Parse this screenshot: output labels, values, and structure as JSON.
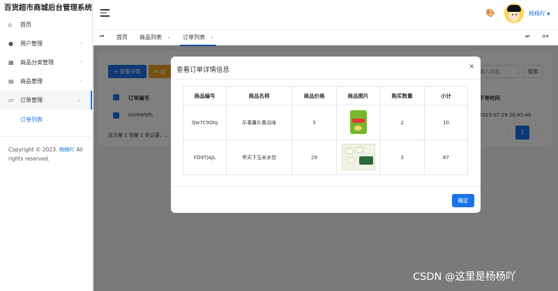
{
  "app": {
    "title": "百货超市商城后台管理系统"
  },
  "sidebar": {
    "items": [
      {
        "label": "首页"
      },
      {
        "label": "用户管理"
      },
      {
        "label": "商品分类管理"
      },
      {
        "label": "商品管理"
      },
      {
        "label": "订单管理"
      }
    ],
    "sub_item": "订单列表",
    "copyright_prefix": "Copyright © 2023.",
    "copyright_author": "杨杨吖",
    "copyright_suffix": "All rights reserved."
  },
  "header": {
    "user_name": "杨杨吖"
  },
  "tabs": [
    {
      "label": "首页"
    },
    {
      "label": "商品列表"
    },
    {
      "label": "订单列表"
    }
  ],
  "toolbar": {
    "view_detail": "+ 查看详情",
    "second_btn": "✎ 修",
    "search_placeholder": "请输入内容",
    "search_button": "搜索"
  },
  "table": {
    "headers": {
      "order_no": "订单编号",
      "time": "下单时间"
    },
    "row": {
      "order_no": "ktV6WNfh",
      "time": "2023-07-29 20:43:49"
    },
    "footer": "显示第 1 到第 1 条记录，..."
  },
  "pagination": {
    "prev": "‹",
    "current": "1",
    "next": "›"
  },
  "modal": {
    "title": "查看订单详情信息",
    "close": "×",
    "columns": [
      "商品编号",
      "商品名称",
      "商品价格",
      "商品图片",
      "购买数量",
      "小计"
    ],
    "rows": [
      {
        "code": "Qw7C9OIq",
        "name": "乐事薯片黄瓜味",
        "price": "5",
        "image": "chips-image",
        "qty": "2",
        "subtotal": "10"
      },
      {
        "code": "FO9TjAJL",
        "name": "甲天下玉米水饺",
        "price": "29",
        "image": "dumplings-image",
        "qty": "3",
        "subtotal": "87"
      }
    ],
    "ok": "确定"
  },
  "watermark": "CSDN @这里是杨杨吖",
  "colors": {
    "primary": "#1a73e8",
    "orange": "#f0a020"
  }
}
